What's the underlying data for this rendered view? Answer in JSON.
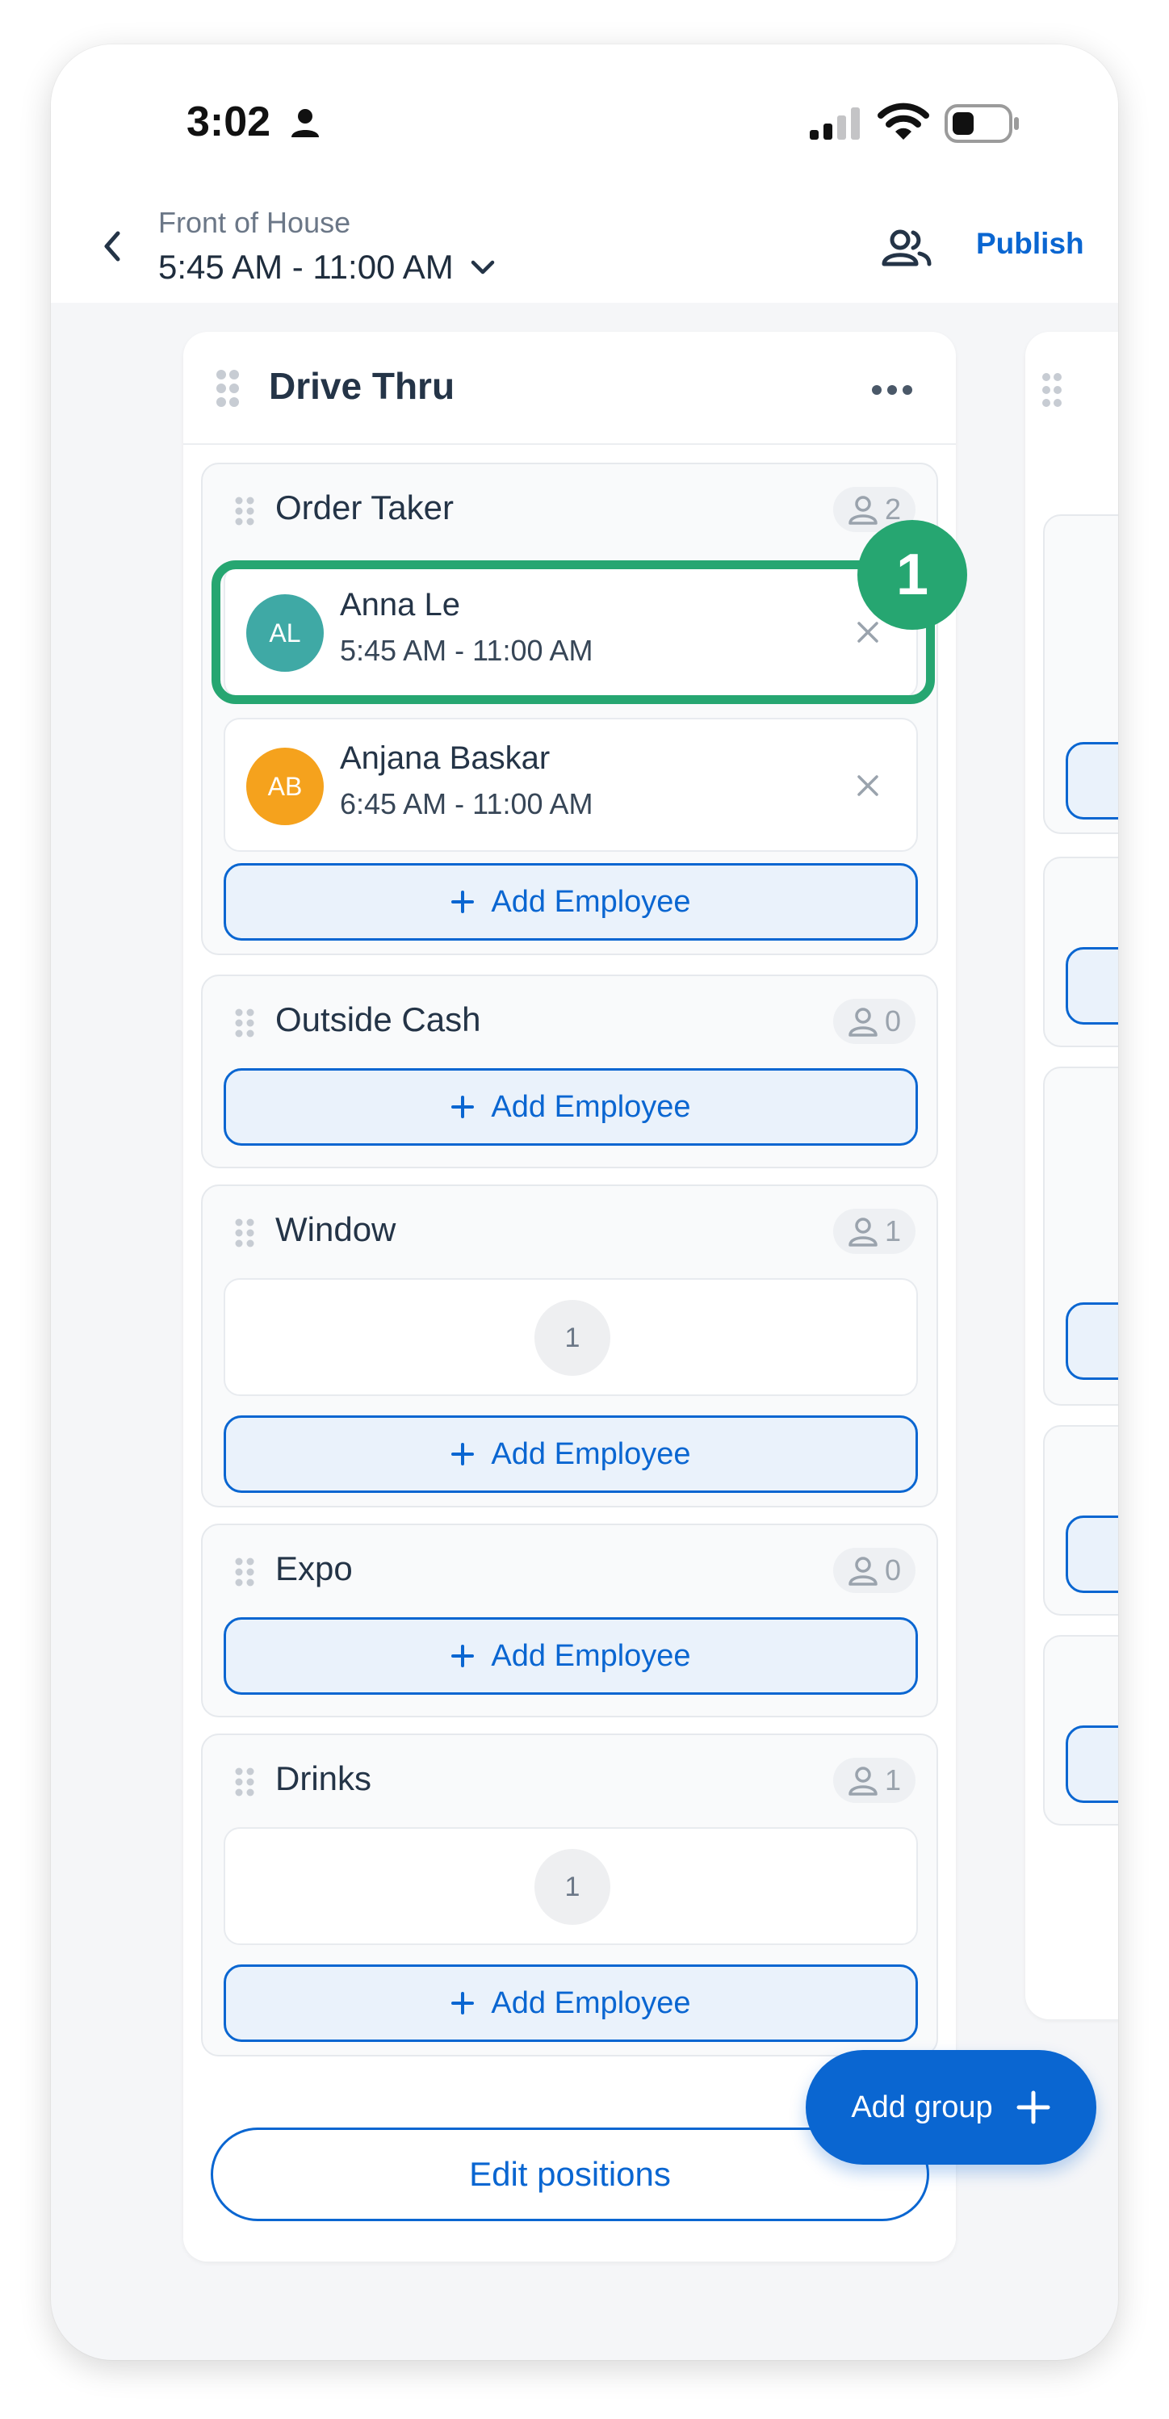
{
  "status_bar": {
    "time": "3:02"
  },
  "header": {
    "subtitle": "Front of House",
    "title": "5:45 AM - 11:00 AM",
    "publish_label": "Publish"
  },
  "group": {
    "title": "Drive Thru",
    "positions": [
      {
        "name": "Order Taker",
        "count": "2",
        "employees": [
          {
            "initials": "AL",
            "name": "Anna Le",
            "time": "5:45 AM - 11:00 AM",
            "color": "#3fa9a5"
          },
          {
            "initials": "AB",
            "name": "Anjana Baskar",
            "time": "6:45 AM - 11:00 AM",
            "color": "#f5a21d"
          }
        ],
        "open_slots": [],
        "add_label": "Add Employee"
      },
      {
        "name": "Outside Cash",
        "count": "0",
        "employees": [],
        "open_slots": [],
        "add_label": "Add Employee"
      },
      {
        "name": "Window",
        "count": "1",
        "employees": [],
        "open_slots": [
          "1"
        ],
        "add_label": "Add Employee"
      },
      {
        "name": "Expo",
        "count": "0",
        "employees": [],
        "open_slots": [],
        "add_label": "Add Employee"
      },
      {
        "name": "Drinks",
        "count": "1",
        "employees": [],
        "open_slots": [
          "1"
        ],
        "add_label": "Add Employee"
      }
    ]
  },
  "footer": {
    "edit_positions_label": "Edit positions",
    "add_group_label": "Add group"
  },
  "annotation": {
    "step": "1",
    "color": "#26a671"
  },
  "colors": {
    "accent": "#0a66d1",
    "highlight": "#26a671"
  }
}
